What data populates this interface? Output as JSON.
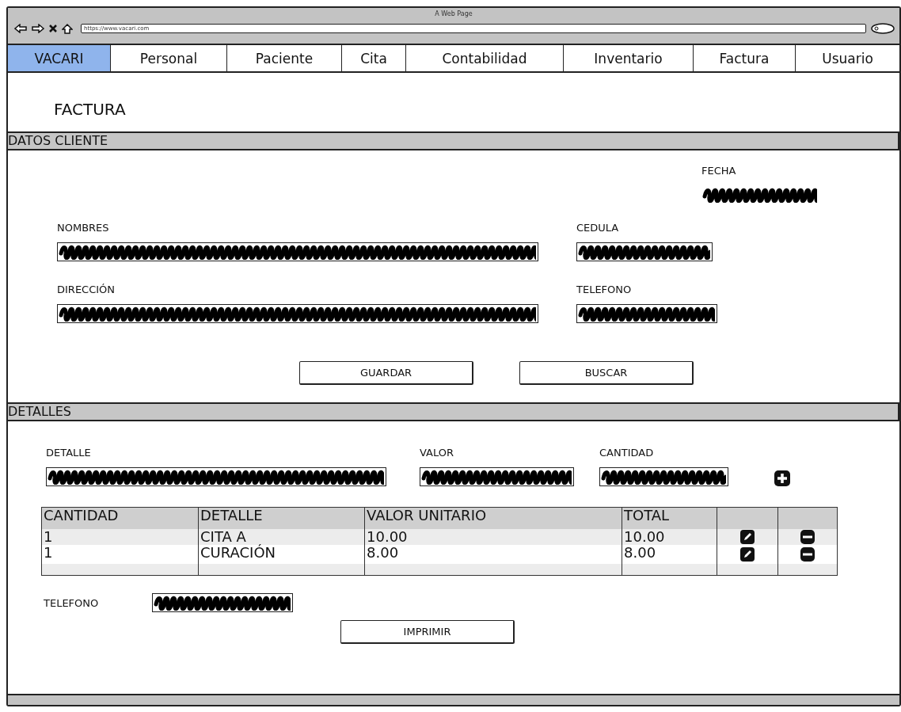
{
  "browser": {
    "title": "A Web Page",
    "url": "https://www.vacari.com"
  },
  "tabs": [
    {
      "label": "VACARI",
      "selected": true
    },
    {
      "label": "Personal",
      "selected": false
    },
    {
      "label": "Paciente",
      "selected": false
    },
    {
      "label": "Cita",
      "selected": false
    },
    {
      "label": "Contabilidad",
      "selected": false
    },
    {
      "label": "Inventario",
      "selected": false
    },
    {
      "label": "Factura",
      "selected": false
    },
    {
      "label": "Usuario",
      "selected": false
    }
  ],
  "page_title": "FACTURA",
  "client_section": {
    "title": "DATOS CLIENTE",
    "date": {
      "label": "FECHA",
      "filled": true,
      "framed": false
    },
    "fields": [
      {
        "label": "NOMBRES",
        "filled": true,
        "framed": true
      },
      {
        "label": "CEDULA",
        "filled": true,
        "framed": true
      },
      {
        "label": "DIRECCIÓN",
        "filled": true,
        "framed": true
      },
      {
        "label": "TELEFONO",
        "filled": true,
        "framed": true
      }
    ],
    "buttons": [
      "GUARDAR",
      "BUSCAR"
    ]
  },
  "details_section": {
    "title": "DETALLES",
    "fields": [
      {
        "label": "DETALLE",
        "filled": true,
        "framed": true
      },
      {
        "label": "VALOR",
        "filled": true,
        "framed": true
      },
      {
        "label": "CANTIDAD",
        "filled": true,
        "framed": true
      }
    ],
    "table": {
      "columns": [
        "CANTIDAD",
        "DETALLE",
        "VALOR UNITARIO",
        "TOTAL"
      ],
      "rows": [
        [
          "1",
          "CITA A",
          "10.00",
          "10.00"
        ],
        [
          "1",
          "CURACIÓN",
          "8.00",
          "8.00"
        ]
      ]
    },
    "phone": {
      "label": "TELEFONO",
      "filled": true,
      "framed": true
    },
    "print_button": "IMPRIMIR"
  }
}
